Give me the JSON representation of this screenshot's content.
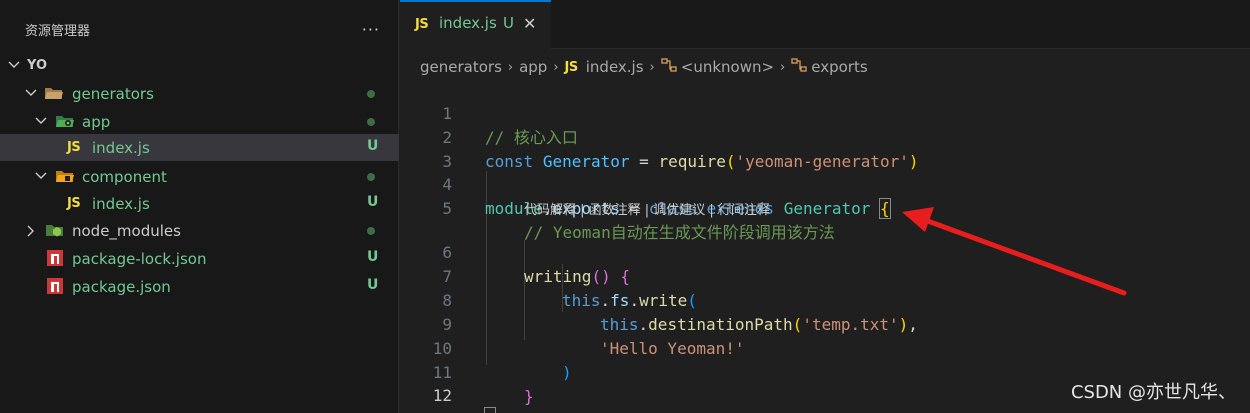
{
  "sidebar": {
    "title": "资源管理器",
    "more": "···",
    "root": "YO",
    "items": [
      {
        "label": "generators",
        "status": "dot"
      },
      {
        "label": "app",
        "status": "dot"
      },
      {
        "label": "index.js",
        "status": "U",
        "icon_text": "JS"
      },
      {
        "label": "component",
        "status": "dot"
      },
      {
        "label": "index.js",
        "status": "U",
        "icon_text": "JS"
      },
      {
        "label": "node_modules",
        "status": "dot"
      },
      {
        "label": "package-lock.json",
        "status": "U"
      },
      {
        "label": "package.json",
        "status": "U"
      }
    ]
  },
  "tab": {
    "icon_text": "JS",
    "name": "index.js",
    "status": "U",
    "close": "✕"
  },
  "breadcrumb": {
    "items": [
      "generators",
      "app",
      "index.js",
      "<unknown>",
      "exports"
    ],
    "js_icon": "JS",
    "separator": "›"
  },
  "code": {
    "line_numbers": [
      "1",
      "2",
      "3",
      "4",
      "5",
      "6",
      "7",
      "8",
      "9",
      "10",
      "11",
      "12"
    ],
    "line1": "// 核心入口",
    "line2": {
      "kw": "const",
      "var": "Generator",
      "op": "=",
      "fn": "require",
      "open": "(",
      "str": "'yeoman-generator'",
      "close": ")"
    },
    "line4": {
      "obj": "module",
      "dot": ".",
      "prop": "exports",
      "op": "=",
      "kw1": "class",
      "kw2": "extends",
      "cls": "Generator",
      "brace": "{"
    },
    "line5": "// Yeoman自动在生成文件阶段调用该方法",
    "codelens": "代码解释 | 函数注释 | 调优建议 | 行间注释",
    "line6": {
      "fn": "writing",
      "parens": "()",
      "brace": "{"
    },
    "line7": {
      "this": "this",
      "dot1": ".",
      "prop": "fs",
      "dot2": ".",
      "fn": "write",
      "open": "("
    },
    "line8": {
      "this": "this",
      "dot": ".",
      "fn": "destinationPath",
      "open": "(",
      "str": "'temp.txt'",
      "close": ")",
      "comma": ","
    },
    "line9": "'Hello Yeoman!'",
    "line10": ")",
    "line11": "}",
    "line12": "}"
  },
  "watermark": "CSDN @亦世凡华、",
  "colors": {
    "accent": "#0078d4",
    "untracked": "#73c991",
    "arrow": "#e81d1d"
  }
}
